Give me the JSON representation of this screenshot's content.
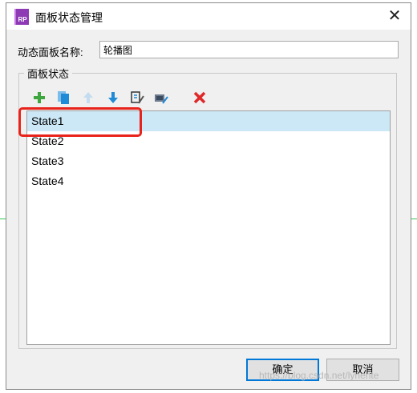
{
  "window": {
    "title": "面板状态管理",
    "app_icon_text": "RP",
    "close_glyph": "✕"
  },
  "form": {
    "name_label": "动态面板名称:",
    "name_value": "轮播图"
  },
  "group": {
    "legend": "面板状态"
  },
  "toolbar": {
    "icons": [
      "add-icon",
      "duplicate-icon",
      "move-up-icon",
      "move-down-icon",
      "edit-states-icon",
      "edit-all-states-icon",
      "delete-icon"
    ]
  },
  "states": {
    "items": [
      {
        "label": "State1",
        "selected": true
      },
      {
        "label": "State2",
        "selected": false
      },
      {
        "label": "State3",
        "selected": false
      },
      {
        "label": "State4",
        "selected": false
      }
    ]
  },
  "buttons": {
    "ok": "确定",
    "cancel": "取消"
  },
  "watermark": "https://blog.csdn.net/lyhente",
  "colors": {
    "accent": "#0078d7",
    "selection": "#cce8f6",
    "highlight": "#e8231b"
  }
}
